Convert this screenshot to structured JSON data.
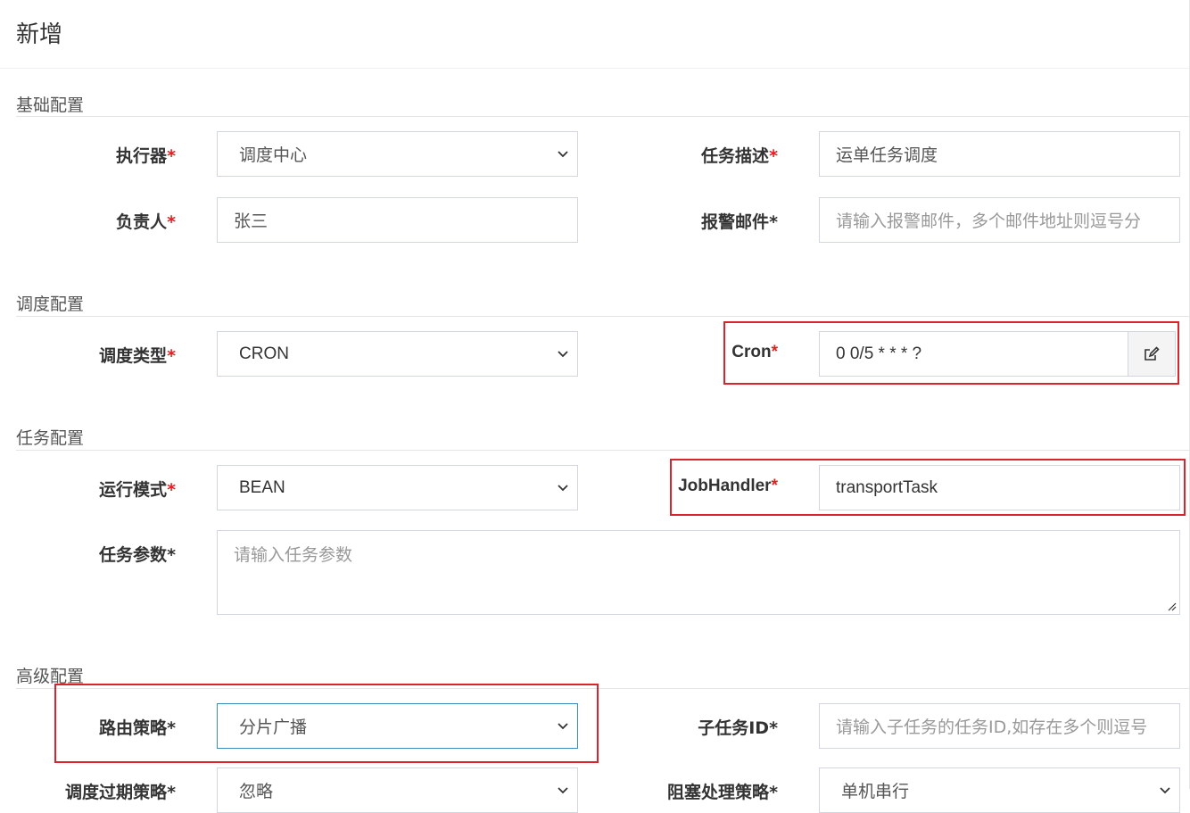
{
  "header": {
    "title": "新增"
  },
  "sections": {
    "basic": "基础配置",
    "schedule": "调度配置",
    "task": "任务配置",
    "advanced": "高级配置"
  },
  "fields": {
    "executor": {
      "label": "执行器",
      "value": "调度中心"
    },
    "description": {
      "label": "任务描述",
      "value": "运单任务调度"
    },
    "owner": {
      "label": "负责人",
      "value": "张三"
    },
    "alarm_email": {
      "label": "报警邮件",
      "placeholder": "请输入报警邮件，多个邮件地址则逗号分"
    },
    "schedule_type": {
      "label": "调度类型",
      "value": "CRON"
    },
    "cron": {
      "label": "Cron",
      "value": "0 0/5 * * * ?"
    },
    "run_mode": {
      "label": "运行模式",
      "value": "BEAN"
    },
    "job_handler": {
      "label": "JobHandler",
      "value": "transportTask"
    },
    "task_params": {
      "label": "任务参数",
      "placeholder": "请输入任务参数"
    },
    "route_strategy": {
      "label": "路由策略",
      "value": "分片广播"
    },
    "child_task_id": {
      "label": "子任务ID",
      "placeholder": "请输入子任务的任务ID,如存在多个则逗号"
    },
    "misfire_strategy": {
      "label": "调度过期策略",
      "value": "忽略"
    },
    "block_strategy": {
      "label": "阻塞处理策略",
      "value": "单机串行"
    }
  },
  "required_mark": "*",
  "colors": {
    "required": "#dd2222",
    "highlight": "#d9232d",
    "focus_border": "#3c8dbc"
  },
  "icons": {
    "select": "chevron-down-icon",
    "cron_edit": "edit-icon"
  }
}
